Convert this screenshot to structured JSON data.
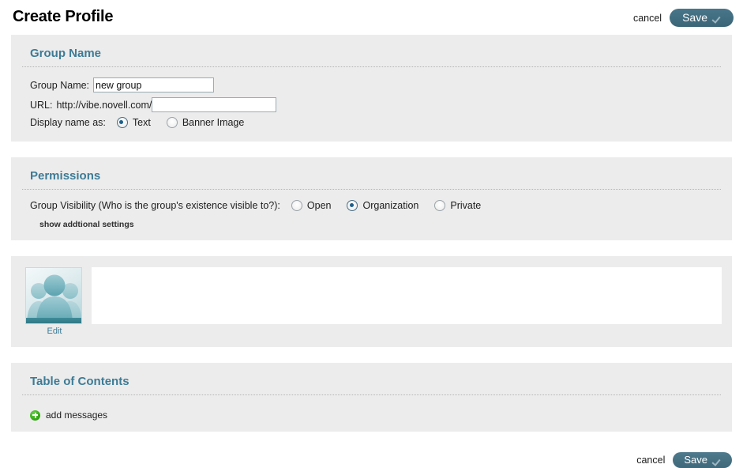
{
  "header": {
    "title": "Create Profile",
    "cancel_label": "cancel",
    "save_label": "Save"
  },
  "group_name_section": {
    "title": "Group Name",
    "group_name_label": "Group Name:",
    "group_name_value": "new group",
    "group_name_placeholder": "",
    "url_label": "URL:",
    "url_prefix": "http://vibe.novell.com/",
    "url_value": "",
    "url_placeholder": "",
    "display_name_label": "Display name as:",
    "display_options": [
      {
        "label": "Text",
        "selected": true
      },
      {
        "label": "Banner Image",
        "selected": false
      }
    ]
  },
  "permissions_section": {
    "title": "Permissions",
    "visibility_label": "Group Visibility (Who is the group's existence visible to?):",
    "visibility_options": [
      {
        "label": "Open",
        "selected": false
      },
      {
        "label": "Organization",
        "selected": true
      },
      {
        "label": "Private",
        "selected": false
      }
    ],
    "show_additional_label": "show addtional settings"
  },
  "media_section": {
    "avatar_alt": "group-avatar",
    "edit_label": "Edit",
    "description_value": ""
  },
  "toc_section": {
    "title": "Table of Contents",
    "add_messages_label": "add messages",
    "add_icon": "plus-circle-icon"
  },
  "footer": {
    "cancel_label": "cancel",
    "save_label": "Save"
  },
  "colors": {
    "panel_bg": "#ececec",
    "section_heading": "#3d7b96",
    "save_button": "#3d6a7a",
    "radio_selected": "#1d5f8a",
    "add_icon_green": "#2fa310",
    "page_bg": "#ffffff"
  }
}
